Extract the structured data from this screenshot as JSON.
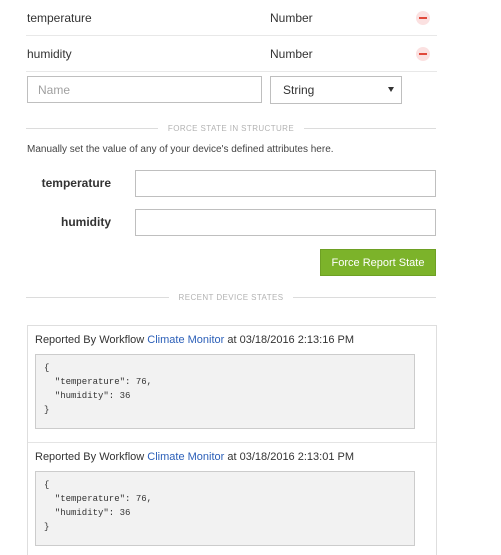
{
  "attributes": [
    {
      "name": "temperature",
      "type": "Number"
    },
    {
      "name": "humidity",
      "type": "Number"
    }
  ],
  "new_attribute": {
    "name_placeholder": "Name",
    "name_value": "",
    "type_selected": "String"
  },
  "force_state": {
    "section_label": "FORCE STATE IN STRUCTURE",
    "helper_text": "Manually set the value of any of your device's defined attributes here.",
    "fields": [
      {
        "label": "temperature",
        "value": ""
      },
      {
        "label": "humidity",
        "value": ""
      }
    ],
    "button_label": "Force Report State"
  },
  "recent_states": {
    "section_label": "RECENT DEVICE STATES",
    "items": [
      {
        "prefix": "Reported By Workflow",
        "workflow": "Climate Monitor",
        "suffix": "at 03/18/2016 2:13:16 PM",
        "payload": "{\n  \"temperature\": 76,\n  \"humidity\": 36\n}"
      },
      {
        "prefix": "Reported By Workflow",
        "workflow": "Climate Monitor",
        "suffix": "at 03/18/2016 2:13:01 PM",
        "payload": "{\n  \"temperature\": 76,\n  \"humidity\": 36\n}"
      }
    ]
  },
  "icons": {
    "remove": "remove-circle-icon",
    "select_caret": "caret-down-icon",
    "scroll_up": "scroll-up-arrow-icon"
  },
  "colors": {
    "accent_green": "#7cb32a",
    "link_blue": "#2b5fb8",
    "remove_red": "#e0493b"
  }
}
